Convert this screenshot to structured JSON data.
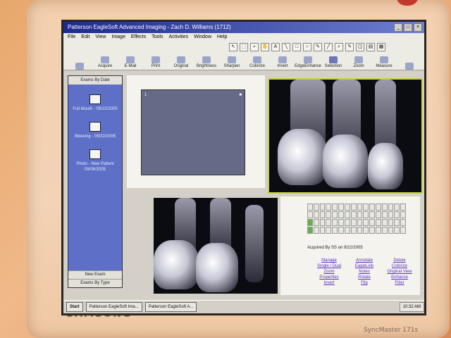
{
  "window": {
    "title": "Patterson EagleSoft Advanced Imaging - Zach D. Williams (1712)"
  },
  "menu": [
    "File",
    "Edit",
    "View",
    "Image",
    "Effects",
    "Tools",
    "Activities",
    "Window",
    "Help"
  ],
  "draw_tools": [
    "↖",
    "⬚",
    "⌕",
    "✋",
    "A",
    "╲",
    "□",
    "○",
    "✎",
    "╱",
    "⌕",
    "✎",
    "◫",
    "▤",
    "▦"
  ],
  "toolbar": [
    {
      "label": "",
      "icon": "pointer-icon"
    },
    {
      "label": "Acquire",
      "icon": "acquire-icon"
    },
    {
      "label": "E-Mail",
      "icon": "email-icon"
    },
    {
      "label": "Print",
      "icon": "print-icon"
    },
    {
      "label": "Original",
      "icon": "original-icon"
    },
    {
      "label": "Brightness",
      "icon": "brightness-icon"
    },
    {
      "label": "Sharpen",
      "icon": "sharpen-icon"
    },
    {
      "label": "Colorize",
      "icon": "colorize-icon"
    },
    {
      "label": "Invert",
      "icon": "invert-icon"
    },
    {
      "label": "EdgeEnhance",
      "icon": "edge-icon"
    },
    {
      "label": "Selection",
      "icon": "selection-icon"
    },
    {
      "label": "Zoom",
      "icon": "zoom-icon"
    },
    {
      "label": "Measure",
      "icon": "measure-icon"
    },
    {
      "label": "",
      "icon": "heart-icon"
    }
  ],
  "sidebar": {
    "header": "Exams By Date",
    "exams": [
      {
        "label": "Full Mouth - 09/22/2005"
      },
      {
        "label": "Bitewing - 09/22/2005"
      },
      {
        "label": "Photo - New Patient 09/08/2005"
      }
    ],
    "footer": [
      "New Exam",
      "Exams By Type"
    ]
  },
  "chart": {
    "acquired": "Acquired By SS on 9/22/2005",
    "links": [
      "Manage",
      "Annotate",
      "Delete",
      "Single / Dual",
      "EagleLink",
      "Colorize",
      "Zoom",
      "Notes",
      "Original View",
      "Properties",
      "Rotate",
      "Enhance",
      "Invert",
      "Flip",
      "Filter"
    ]
  },
  "taskbar": {
    "start": "Start",
    "items": [
      "Patterson EagleSoft Ima...",
      "Patterson EagleSoft A..."
    ],
    "clock": "10:32 AM"
  },
  "monitor": {
    "brand": "SAMSUNG",
    "model": "SyncMaster 171s"
  },
  "colors": {
    "sidebar": "#5d6fc6",
    "selection_border": "#c8d63a",
    "link": "#5a2fc0"
  }
}
